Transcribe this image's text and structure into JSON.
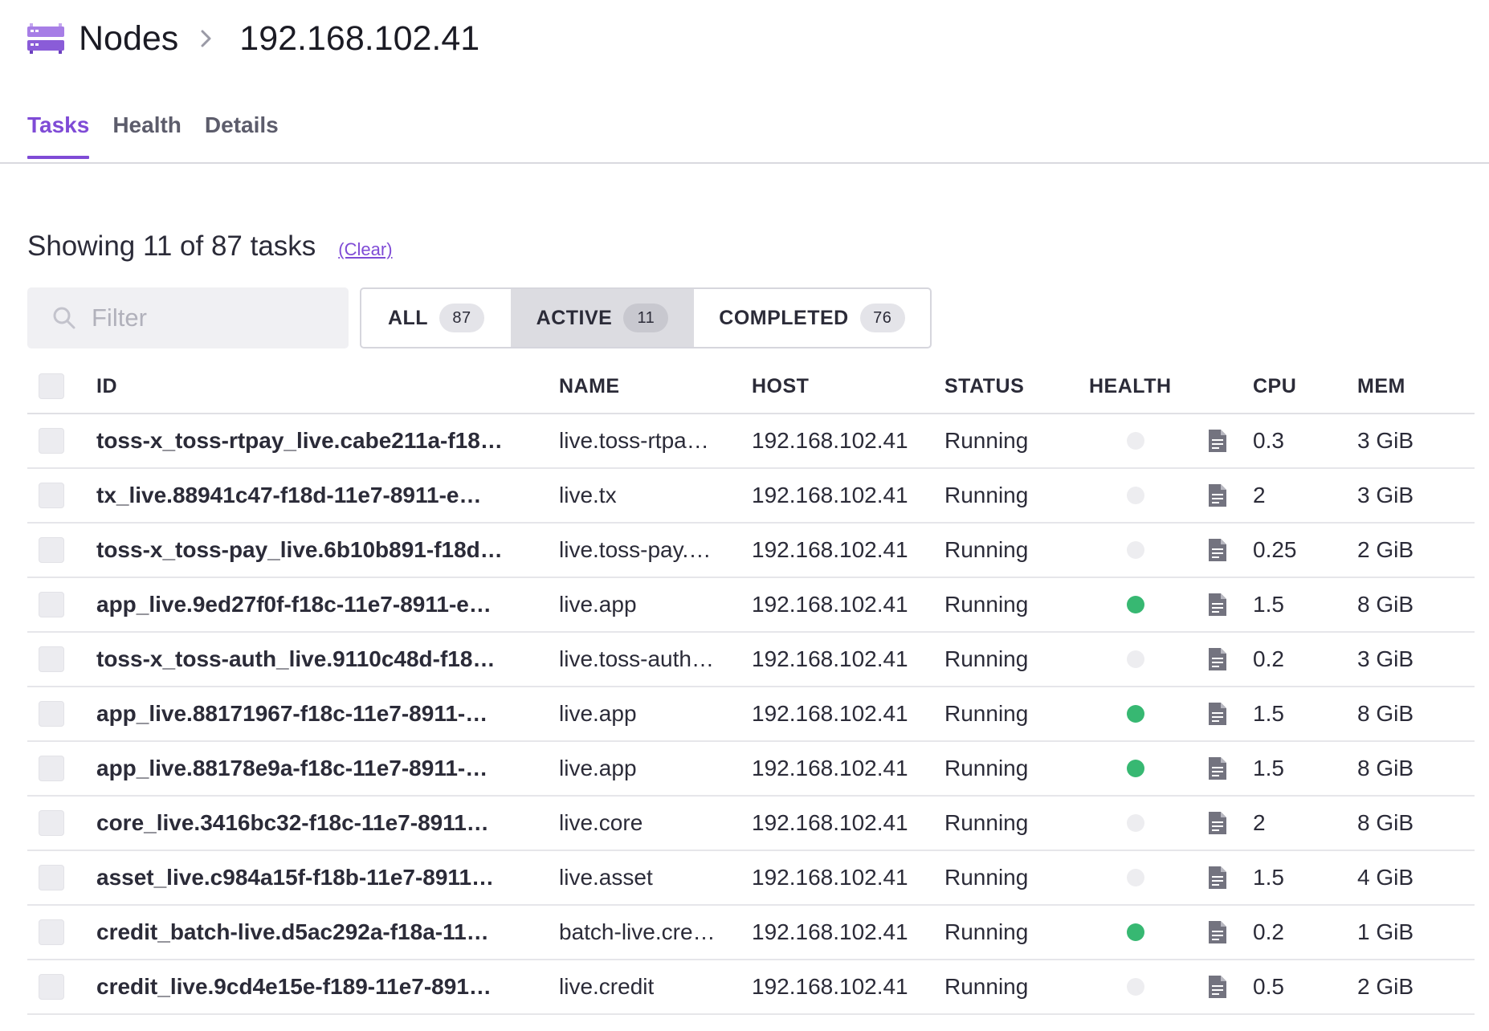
{
  "breadcrumb": {
    "root_icon": "nodes-icon",
    "root": "Nodes",
    "separator_icon": "chevron-right-icon",
    "current": "192.168.102.41"
  },
  "tabs": [
    {
      "label": "Tasks",
      "active": true
    },
    {
      "label": "Health",
      "active": false
    },
    {
      "label": "Details",
      "active": false
    }
  ],
  "summary": {
    "text": "Showing 11 of 87 tasks",
    "clear_label": "(Clear)"
  },
  "filter": {
    "icon": "search-icon",
    "placeholder": "Filter",
    "value": ""
  },
  "segments": [
    {
      "label": "ALL",
      "count": "87",
      "active": false
    },
    {
      "label": "ACTIVE",
      "count": "11",
      "active": true
    },
    {
      "label": "COMPLETED",
      "count": "76",
      "active": false
    }
  ],
  "table": {
    "columns": [
      "ID",
      "NAME",
      "HOST",
      "STATUS",
      "HEALTH",
      "CPU",
      "MEM"
    ],
    "rows": [
      {
        "id": "toss-x_toss-rtpay_live.cabe211a-f18…",
        "name": "live.toss-rtpa…",
        "host": "192.168.102.41",
        "status": "Running",
        "healthy": false,
        "cpu": "0.3",
        "mem": "3 GiB"
      },
      {
        "id": "tx_live.88941c47-f18d-11e7-8911-e…",
        "name": "live.tx",
        "host": "192.168.102.41",
        "status": "Running",
        "healthy": false,
        "cpu": "2",
        "mem": "3 GiB"
      },
      {
        "id": "toss-x_toss-pay_live.6b10b891-f18d…",
        "name": "live.toss-pay.…",
        "host": "192.168.102.41",
        "status": "Running",
        "healthy": false,
        "cpu": "0.25",
        "mem": "2 GiB"
      },
      {
        "id": "app_live.9ed27f0f-f18c-11e7-8911-e…",
        "name": "live.app",
        "host": "192.168.102.41",
        "status": "Running",
        "healthy": true,
        "cpu": "1.5",
        "mem": "8 GiB"
      },
      {
        "id": "toss-x_toss-auth_live.9110c48d-f18…",
        "name": "live.toss-auth…",
        "host": "192.168.102.41",
        "status": "Running",
        "healthy": false,
        "cpu": "0.2",
        "mem": "3 GiB"
      },
      {
        "id": "app_live.88171967-f18c-11e7-8911-…",
        "name": "live.app",
        "host": "192.168.102.41",
        "status": "Running",
        "healthy": true,
        "cpu": "1.5",
        "mem": "8 GiB"
      },
      {
        "id": "app_live.88178e9a-f18c-11e7-8911-…",
        "name": "live.app",
        "host": "192.168.102.41",
        "status": "Running",
        "healthy": true,
        "cpu": "1.5",
        "mem": "8 GiB"
      },
      {
        "id": "core_live.3416bc32-f18c-11e7-8911…",
        "name": "live.core",
        "host": "192.168.102.41",
        "status": "Running",
        "healthy": false,
        "cpu": "2",
        "mem": "8 GiB"
      },
      {
        "id": "asset_live.c984a15f-f18b-11e7-8911…",
        "name": "live.asset",
        "host": "192.168.102.41",
        "status": "Running",
        "healthy": false,
        "cpu": "1.5",
        "mem": "4 GiB"
      },
      {
        "id": "credit_batch-live.d5ac292a-f18a-11…",
        "name": "batch-live.cre…",
        "host": "192.168.102.41",
        "status": "Running",
        "healthy": true,
        "cpu": "0.2",
        "mem": "1 GiB"
      },
      {
        "id": "credit_live.9cd4e15e-f189-11e7-891…",
        "name": "live.credit",
        "host": "192.168.102.41",
        "status": "Running",
        "healthy": false,
        "cpu": "0.5",
        "mem": "2 GiB"
      }
    ]
  },
  "colors": {
    "accent": "#7f4bd6",
    "healthy": "#37b872",
    "unknown": "#ededf0"
  }
}
